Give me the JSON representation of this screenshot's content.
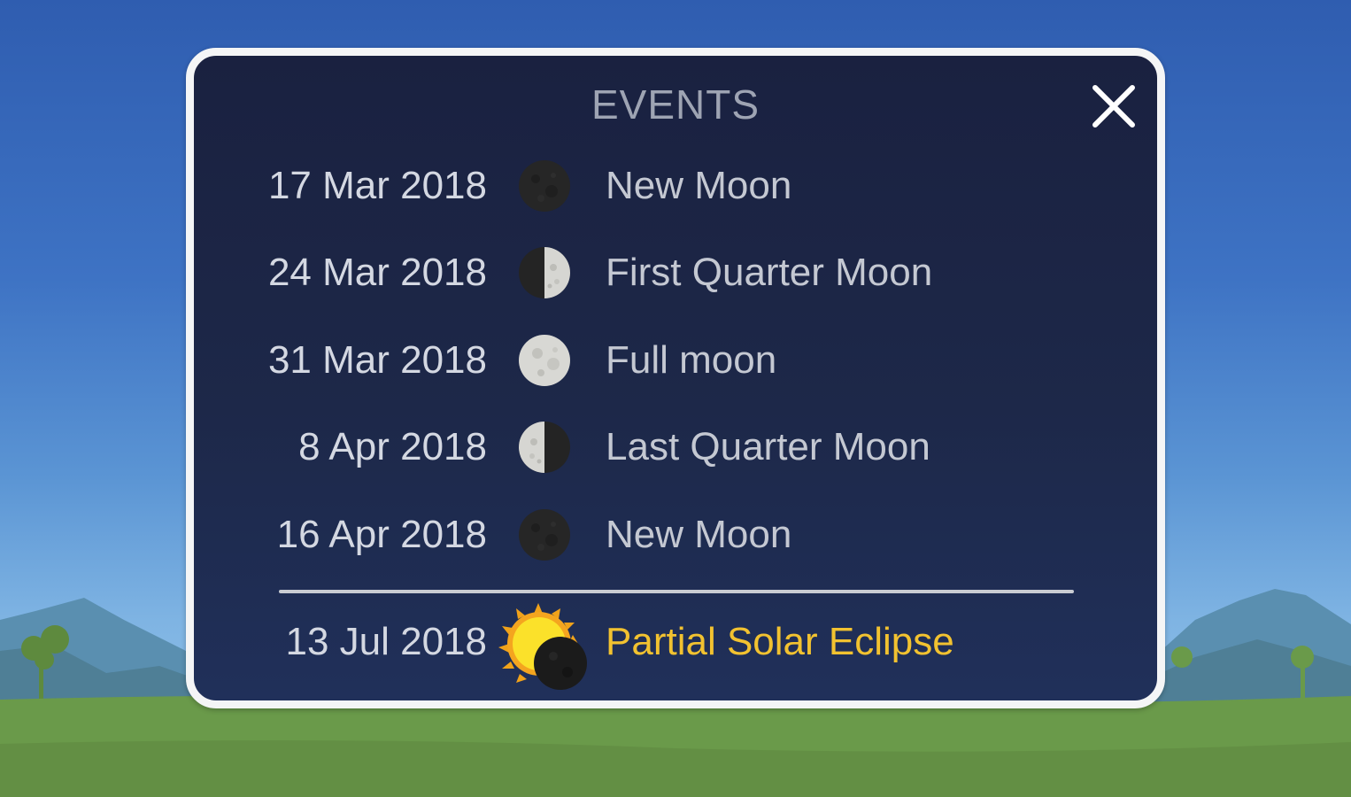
{
  "dialog": {
    "title": "EVENTS",
    "close_icon": "close-icon"
  },
  "events": [
    {
      "date": "17 Mar 2018",
      "name": "New Moon",
      "icon": "new-moon-icon"
    },
    {
      "date": "24 Mar 2018",
      "name": "First Quarter Moon",
      "icon": "first-quarter-moon-icon"
    },
    {
      "date": "31 Mar 2018",
      "name": "Full moon",
      "icon": "full-moon-icon"
    },
    {
      "date": "8 Apr 2018",
      "name": "Last Quarter Moon",
      "icon": "last-quarter-moon-icon"
    },
    {
      "date": "16 Apr 2018",
      "name": "New Moon",
      "icon": "new-moon-icon"
    }
  ],
  "special_event": {
    "date": "13 Jul 2018",
    "name": "Partial Solar Eclipse",
    "icon": "solar-eclipse-icon"
  },
  "colors": {
    "panel_background": "#1d2849",
    "panel_border": "#f4f5f6",
    "event_text": "#c4c8d2",
    "special_text": "#f2c230",
    "sky_top": "#2f5db0",
    "grass": "#6a9a4a"
  }
}
